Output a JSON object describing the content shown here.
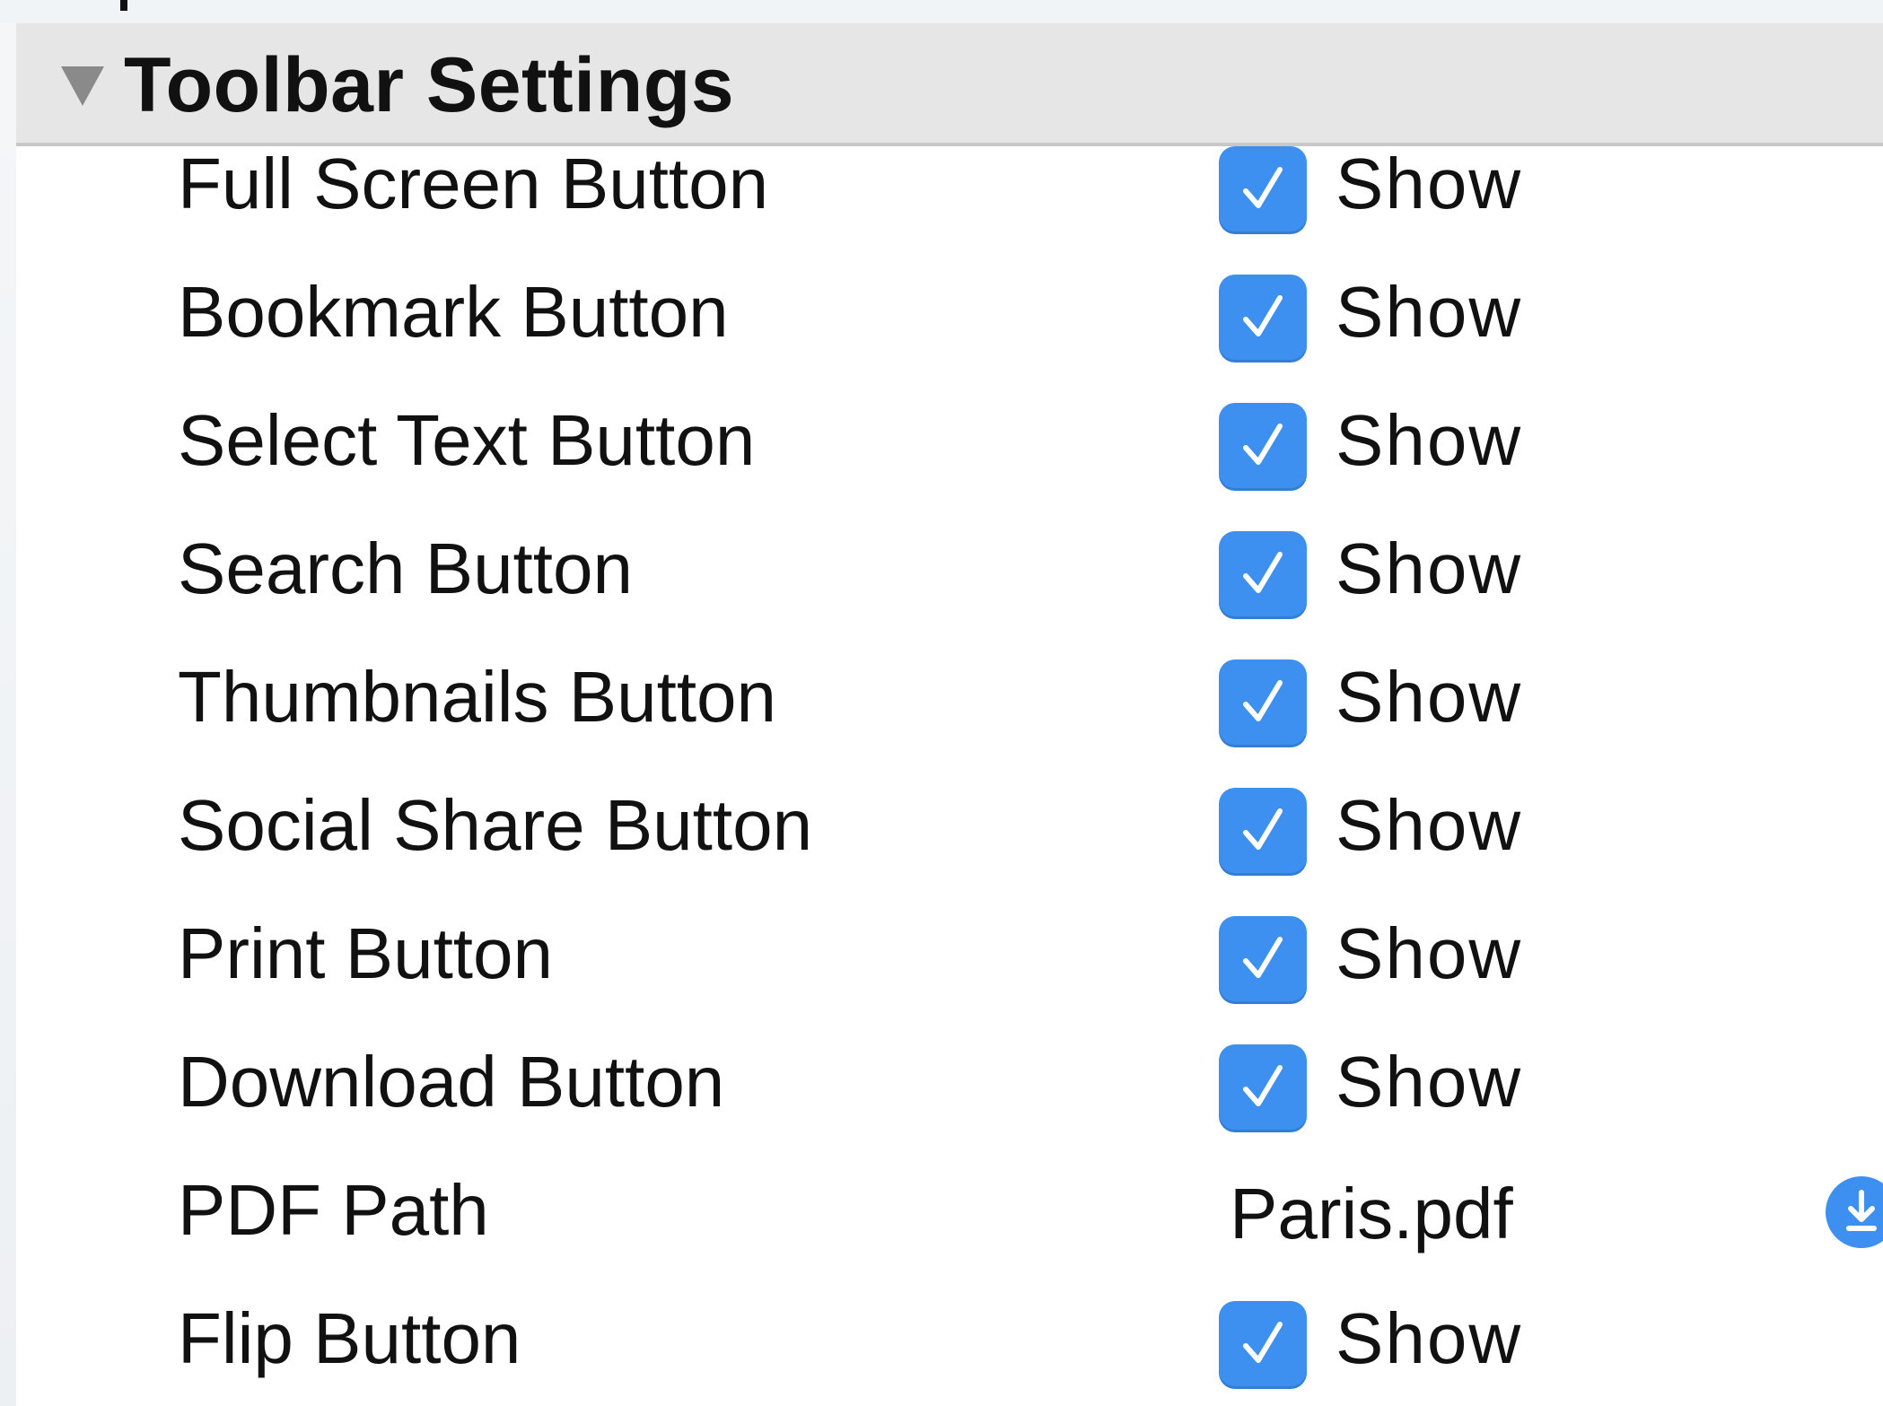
{
  "section": {
    "title": "Toolbar Settings",
    "icon": "disclosure-triangle-down-icon"
  },
  "rows": [
    {
      "label": "Full Screen Button",
      "checked": true,
      "value": "Show"
    },
    {
      "label": "Bookmark Button",
      "checked": true,
      "value": "Show"
    },
    {
      "label": "Select Text Button",
      "checked": true,
      "value": "Show"
    },
    {
      "label": "Search Button",
      "checked": true,
      "value": "Show"
    },
    {
      "label": "Thumbnails Button",
      "checked": true,
      "value": "Show"
    },
    {
      "label": "Social Share Button",
      "checked": true,
      "value": "Show"
    },
    {
      "label": "Print Button",
      "checked": true,
      "value": "Show"
    },
    {
      "label": "Download Button",
      "checked": true,
      "value": "Show"
    },
    {
      "label": "PDF Path",
      "path": "Paris.pdf",
      "icon": "download-icon"
    },
    {
      "label": "Flip Button",
      "checked": true,
      "value": "Show"
    }
  ],
  "colors": {
    "accent": "#3d8ff0",
    "header_bg": "#e6e6e6",
    "text": "#111111"
  }
}
